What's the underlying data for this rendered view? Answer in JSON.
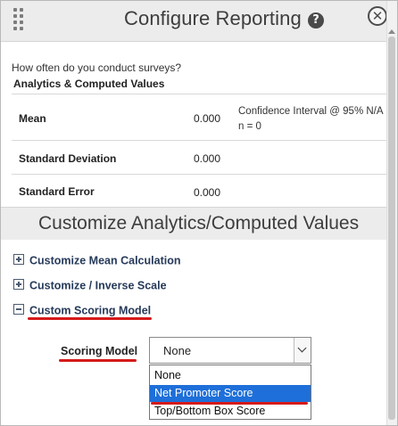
{
  "dialog": {
    "title": "Configure Reporting",
    "help_icon": "question-circle-icon",
    "help_glyph": "?",
    "close_icon": "close-circle-icon",
    "close_glyph": "✕",
    "grip_icon": "drag-grip-icon"
  },
  "question": "How often do you conduct surveys?",
  "section_label": "Analytics & Computed Values",
  "stats": [
    {
      "name": "Mean",
      "value": "0.000",
      "extra_line1": "Confidence Interval @ 95% N/A",
      "extra_line2": "n = 0"
    },
    {
      "name": "Standard Deviation",
      "value": "0.000"
    },
    {
      "name": "Standard Error",
      "value": "0.000"
    }
  ],
  "customize": {
    "title": "Customize Analytics/Computed Values",
    "options": [
      {
        "label": "Customize Mean Calculation",
        "state": "collapsed"
      },
      {
        "label": "Customize / Inverse Scale",
        "state": "collapsed"
      },
      {
        "label": "Custom Scoring Model",
        "state": "expanded"
      }
    ]
  },
  "scoring": {
    "label": "Scoring Model",
    "selected": "None",
    "options": [
      "None",
      "Net Promoter Score",
      "Top/Bottom Box Score"
    ],
    "highlighted_index": 1
  },
  "colors": {
    "annotation_red": "#d51a1a",
    "highlight_blue": "#1e6fd9",
    "header_bg": "#ececec"
  }
}
